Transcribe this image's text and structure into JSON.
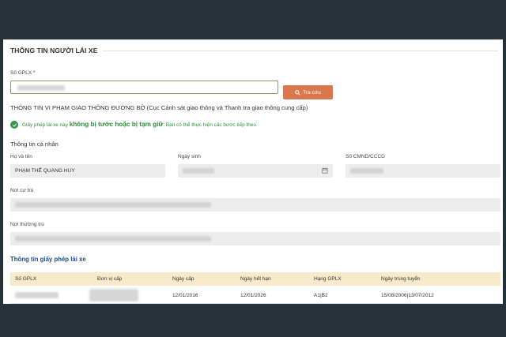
{
  "section": {
    "title": "THÔNG TIN NGƯỜI LÁI XE"
  },
  "gplx": {
    "label": "Số GPLX *",
    "value": ""
  },
  "search_button": {
    "label": "Tra cứu",
    "icon": "search-icon"
  },
  "violation": {
    "title": "THÔNG TIN VI PHẠM GIAO THÔNG ĐƯỜNG BỘ (Cục Cảnh sát giao thông và Thanh tra giao thông cung cấp)",
    "status_prefix": "Giấy phép lái xe này",
    "status_emphasis": "không bị tước hoặc bị tạm giữ",
    "status_suffix": ". Bạn có thể thực hiện các bước tiếp theo.",
    "status_color": "#2e8b3e"
  },
  "personal": {
    "title": "Thông tin cá nhân",
    "name_label": "Họ và tên",
    "name_value": "PHẠM THẾ QUANG HUY",
    "dob_label": "Ngày sinh",
    "id_label": "Số CMND/CCCD",
    "residence_label": "Nơi cư trú",
    "permanent_label": "Nơi thường trú"
  },
  "license_table": {
    "title": "Thông tin giấy phép lái xe",
    "headers": [
      "Số GPLX",
      "Đơn vị cấp",
      "Ngày cấp",
      "Ngày hết hạn",
      "Hạng GPLX",
      "Ngày trúng tuyển"
    ],
    "row": {
      "issue_date": "12/01/2016",
      "expiry_date": "12/01/2026",
      "class": "A1|B2",
      "pass_date": "15/08/2006|13/07/2012"
    },
    "header_color": "#f7e9c9",
    "title_color": "#1d4f86"
  },
  "colors": {
    "accent": "#d9784f",
    "success": "#2e9a4a",
    "frame": "#263238"
  }
}
